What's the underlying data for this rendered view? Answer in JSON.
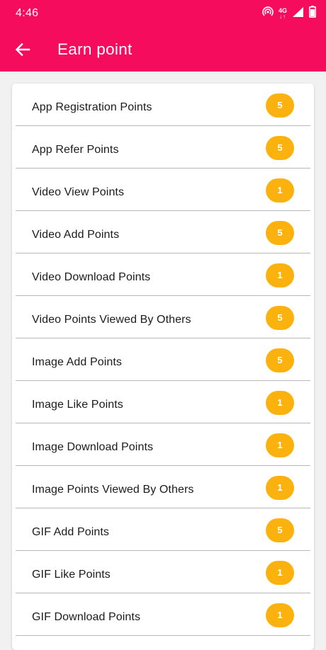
{
  "status_bar": {
    "time": "4:46",
    "network": "4G",
    "icons": [
      "hotspot-icon",
      "network-4g-icon",
      "signal-icon",
      "battery-icon"
    ]
  },
  "toolbar": {
    "title": "Earn point",
    "back_icon": "arrow-back-icon"
  },
  "colors": {
    "appbar": "#f50c5c",
    "badge": "#fbb20e",
    "background": "#f1f1f1"
  },
  "points": [
    {
      "label": "App Registration Points",
      "value": "5"
    },
    {
      "label": "App Refer Points",
      "value": "5"
    },
    {
      "label": "Video View Points",
      "value": "1"
    },
    {
      "label": "Video Add Points",
      "value": "5"
    },
    {
      "label": "Video Download Points",
      "value": "1"
    },
    {
      "label": "Video Points Viewed By Others",
      "value": "5"
    },
    {
      "label": "Image Add Points",
      "value": "5"
    },
    {
      "label": "Image Like Points",
      "value": "1"
    },
    {
      "label": "Image Download Points",
      "value": "1"
    },
    {
      "label": "Image Points Viewed By Others",
      "value": "1"
    },
    {
      "label": "GIF Add Points",
      "value": "5"
    },
    {
      "label": "GIF Like Points",
      "value": "1"
    },
    {
      "label": "GIF Download Points",
      "value": "1"
    }
  ]
}
